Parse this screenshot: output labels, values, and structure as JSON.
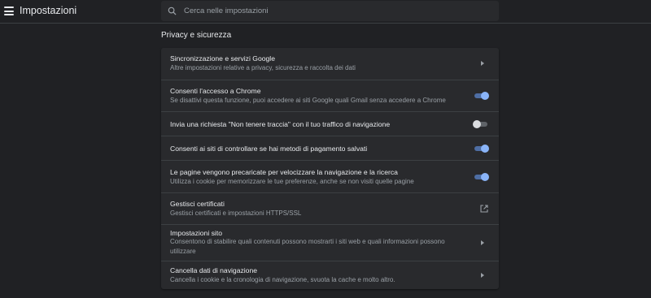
{
  "header": {
    "title": "Impostazioni",
    "search_placeholder": "Cerca nelle impostazioni"
  },
  "section": {
    "title": "Privacy e sicurezza"
  },
  "rows": [
    {
      "title": "Sincronizzazione e servizi Google",
      "subtitle": "Altre impostazioni relative a privacy, sicurezza e raccolta dei dati",
      "control": "chevron"
    },
    {
      "title": "Consenti l'accesso a Chrome",
      "subtitle": "Se disattivi questa funzione, puoi accedere ai siti Google quali Gmail senza accedere a Chrome",
      "control": "toggle",
      "enabled": true
    },
    {
      "title": "Invia una richiesta \"Non tenere traccia\" con il tuo traffico di navigazione",
      "control": "toggle",
      "enabled": false
    },
    {
      "title": "Consenti ai siti di controllare se hai metodi di pagamento salvati",
      "control": "toggle",
      "enabled": true
    },
    {
      "title": "Le pagine vengono precaricate per velocizzare la navigazione e la ricerca",
      "subtitle": "Utilizza i cookie per memorizzare le tue preferenze, anche se non visiti quelle pagine",
      "control": "toggle",
      "enabled": true
    },
    {
      "title": "Gestisci certificati",
      "subtitle": "Gestisci certificati e impostazioni HTTPS/SSL",
      "control": "external-link"
    },
    {
      "title": "Impostazioni sito",
      "subtitle": "Consentono di stabilire quali contenuti possono mostrarti i siti web e quali informazioni possono utilizzare",
      "control": "chevron"
    },
    {
      "title": "Cancella dati di navigazione",
      "subtitle": "Cancella i cookie e la cronologia di navigazione, svuota la cache e molto altro.",
      "control": "chevron"
    }
  ],
  "icons": {
    "menu": "hamburger-menu-icon",
    "search": "search-icon",
    "chevron": "chevron-right-icon",
    "external": "open-in-new-icon"
  },
  "colors": {
    "background": "#202124",
    "card": "#292a2d",
    "accent": "#8ab4f8",
    "secondary_text": "#9aa0a6"
  }
}
